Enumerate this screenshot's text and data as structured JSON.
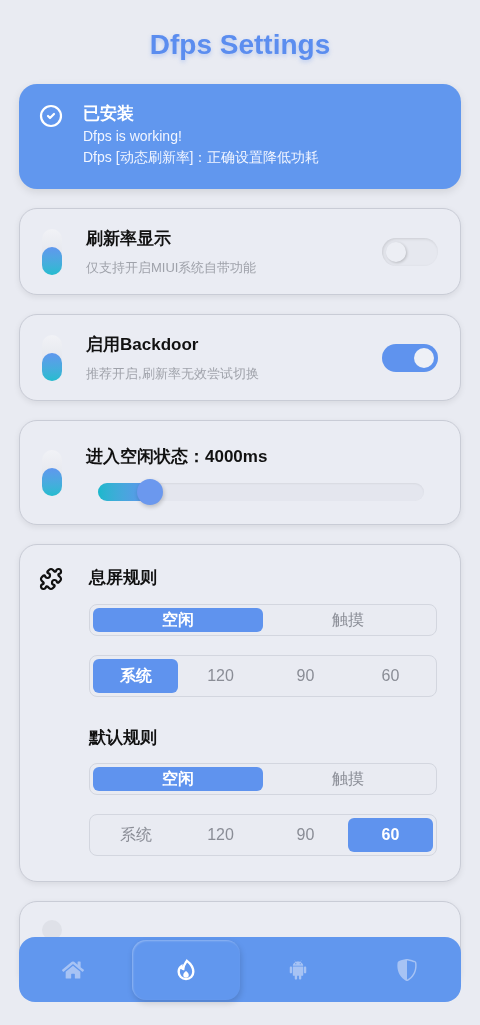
{
  "title": "Dfps Settings",
  "status_card": {
    "title": "已安装",
    "lines": [
      "Dfps is working!",
      "Dfps [动态刷新率]：正确设置降低功耗"
    ]
  },
  "settings": [
    {
      "kind": "toggle",
      "title": "刷新率显示",
      "subtitle": "仅支持开启MIUI系统自带功能",
      "on": false
    },
    {
      "kind": "toggle",
      "title": "启用Backdoor",
      "subtitle": "推荐开启,刷新率无效尝试切换",
      "on": true
    },
    {
      "kind": "slider",
      "title": "进入空闲状态：4000ms",
      "level": 0.16
    }
  ],
  "rules_card": {
    "sections": [
      {
        "title": "息屏规则",
        "modes": [
          {
            "label": "空闲",
            "selected": true
          },
          {
            "label": "触摸",
            "selected": false
          }
        ],
        "rates": [
          {
            "label": "系统",
            "selected": true
          },
          {
            "label": "120",
            "selected": false
          },
          {
            "label": "90",
            "selected": false
          },
          {
            "label": "60",
            "selected": false
          }
        ]
      },
      {
        "title": "默认规则",
        "modes": [
          {
            "label": "空闲",
            "selected": true
          },
          {
            "label": "触摸",
            "selected": false
          }
        ],
        "rates": [
          {
            "label": "系统",
            "selected": false
          },
          {
            "label": "120",
            "selected": false
          },
          {
            "label": "90",
            "selected": false
          },
          {
            "label": "60",
            "selected": true
          }
        ]
      }
    ]
  },
  "nav": [
    {
      "kind": "home",
      "selected": false
    },
    {
      "kind": "flame",
      "selected": true
    },
    {
      "kind": "android",
      "selected": false
    },
    {
      "kind": "shield",
      "selected": false
    }
  ]
}
